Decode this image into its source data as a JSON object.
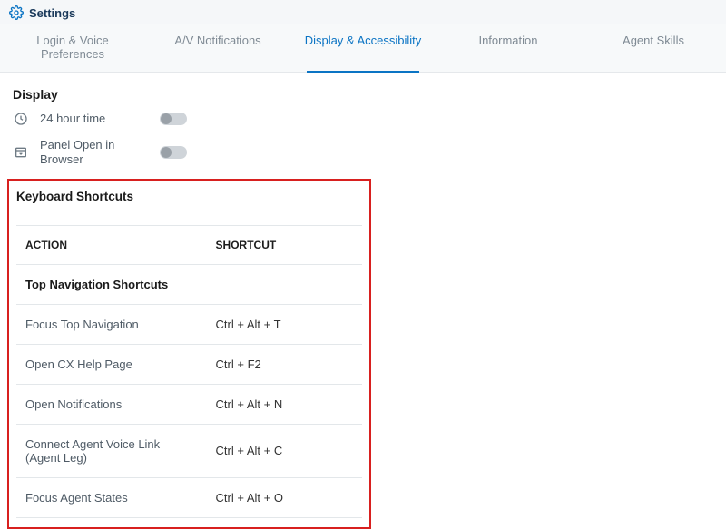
{
  "header": {
    "title": "Settings"
  },
  "tabs": [
    {
      "label": "Login & Voice Preferences",
      "active": false
    },
    {
      "label": "A/V Notifications",
      "active": false
    },
    {
      "label": "Display & Accessibility",
      "active": true
    },
    {
      "label": "Information",
      "active": false
    },
    {
      "label": "Agent Skills",
      "active": false
    }
  ],
  "display": {
    "section_title": "Display",
    "items": [
      {
        "label": "24 hour time",
        "icon": "clock-icon"
      },
      {
        "label": "Panel Open in Browser",
        "icon": "panel-open-icon"
      }
    ]
  },
  "keyboard_shortcuts": {
    "section_title": "Keyboard Shortcuts",
    "columns": {
      "action": "ACTION",
      "shortcut": "SHORTCUT"
    },
    "group_label": "Top Navigation Shortcuts",
    "rows": [
      {
        "action": "Focus Top Navigation",
        "shortcut": "Ctrl + Alt + T"
      },
      {
        "action": "Open CX Help Page",
        "shortcut": "Ctrl + F2"
      },
      {
        "action": "Open Notifications",
        "shortcut": "Ctrl + Alt + N"
      },
      {
        "action": "Connect Agent Voice Link (Agent Leg)",
        "shortcut": "Ctrl + Alt + C"
      },
      {
        "action": "Focus Agent States",
        "shortcut": "Ctrl + Alt + O"
      }
    ]
  }
}
